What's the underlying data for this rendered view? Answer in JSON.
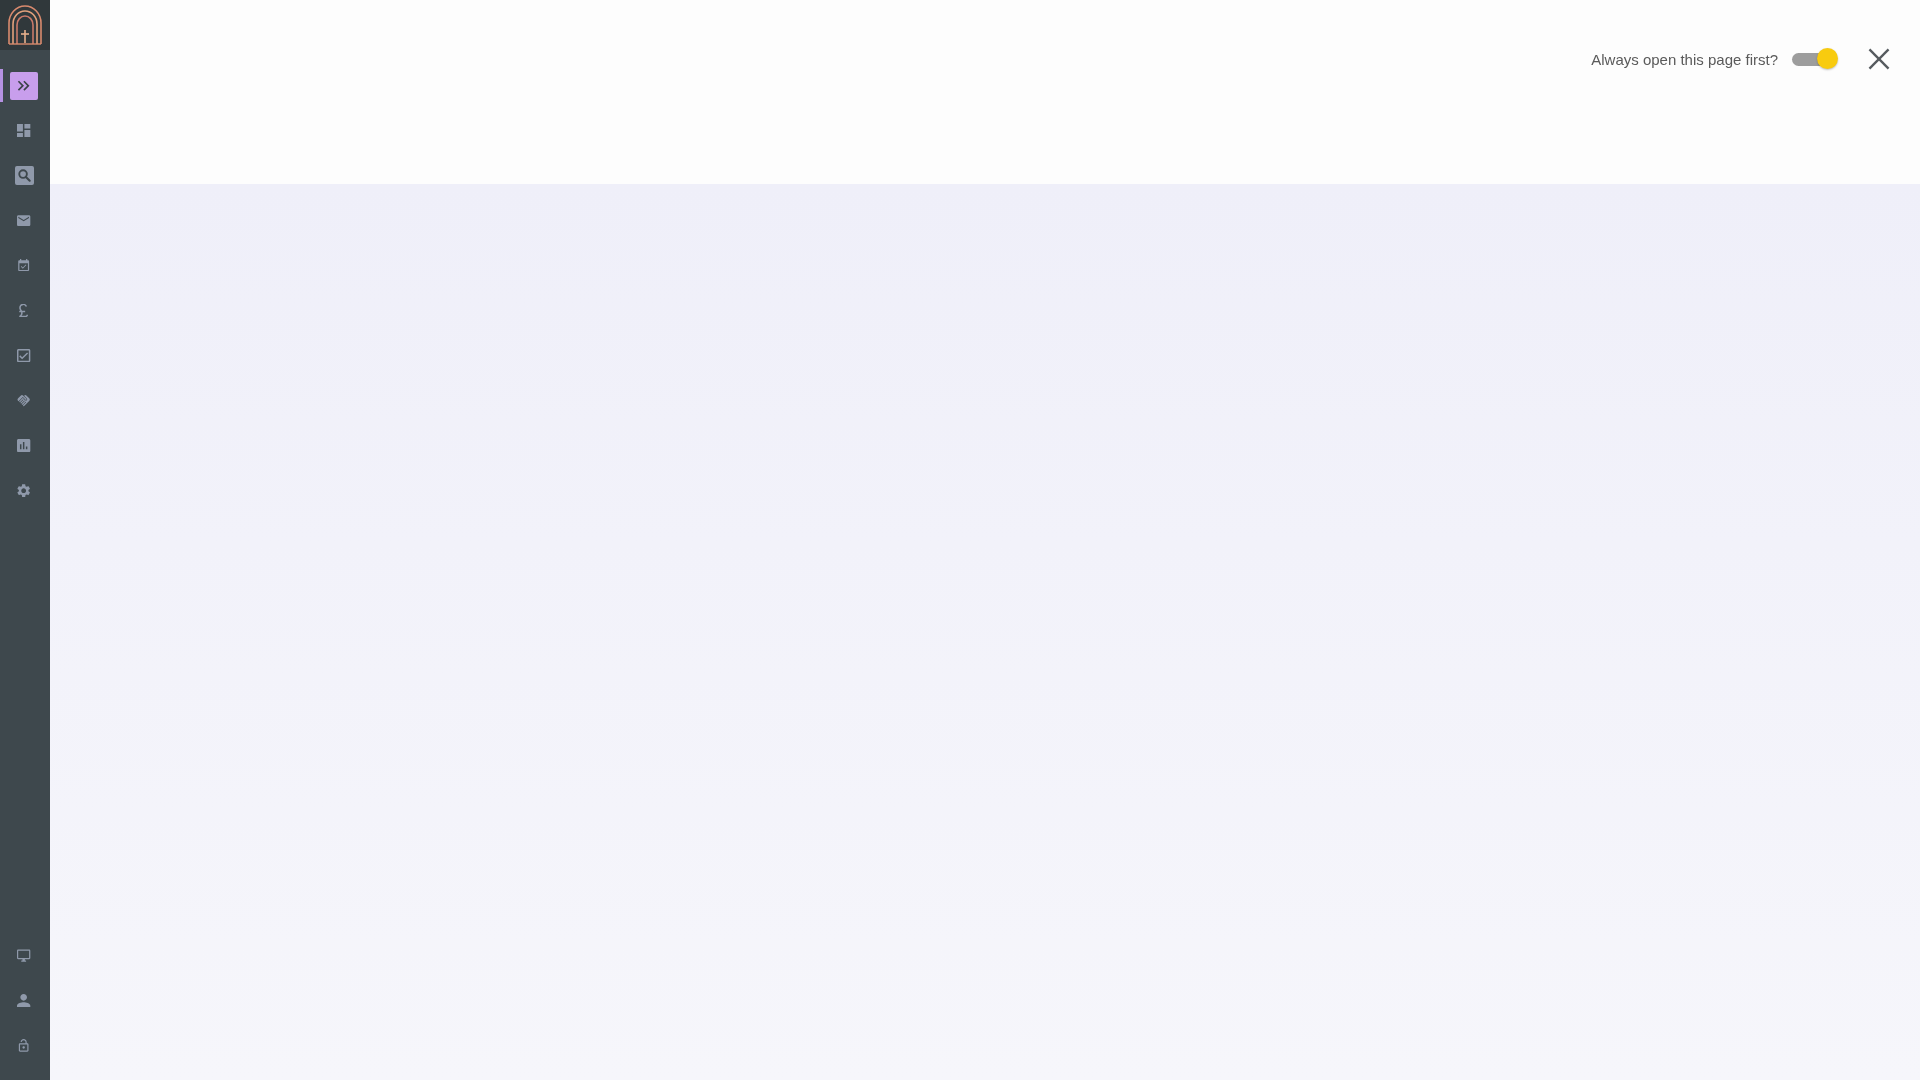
{
  "sidebar": {
    "nav_items": [
      {
        "selected": true
      },
      {
        "selected": false
      },
      {
        "selected": false
      },
      {
        "selected": false
      },
      {
        "selected": false
      },
      {
        "selected": false
      },
      {
        "selected": false
      },
      {
        "selected": false
      },
      {
        "selected": false
      },
      {
        "selected": false
      }
    ],
    "footer_items": [
      {
        "selected": false
      },
      {
        "selected": false
      },
      {
        "selected": false
      }
    ]
  },
  "header": {
    "always_open": {
      "label": "Always open this page first?",
      "on": true
    }
  }
}
